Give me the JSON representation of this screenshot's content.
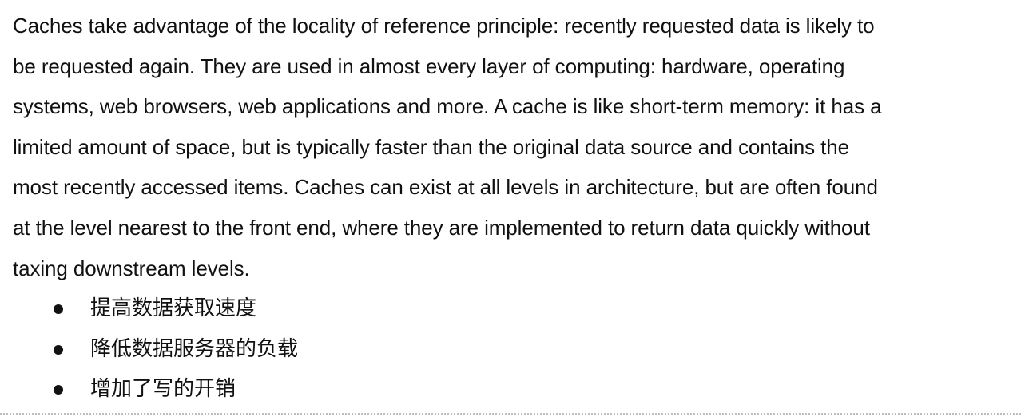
{
  "document": {
    "paragraph": "Caches take advantage of the locality of reference principle: recently requested data is likely to\nbe requested again. They are used in almost every layer of computing: hardware, operating\nsystems, web browsers, web applications and more. A cache is like short-term memory: it has a\nlimited amount of space, but is typically faster than the original data source and contains the\nmost recently accessed items. Caches can exist at all levels in architecture, but are often found\nat the level nearest to the front end, where they are implemented to return data quickly without\ntaxing downstream levels.",
    "bullets": [
      "提高数据获取速度",
      "降低数据服务器的负载",
      "增加了写的开销"
    ]
  }
}
